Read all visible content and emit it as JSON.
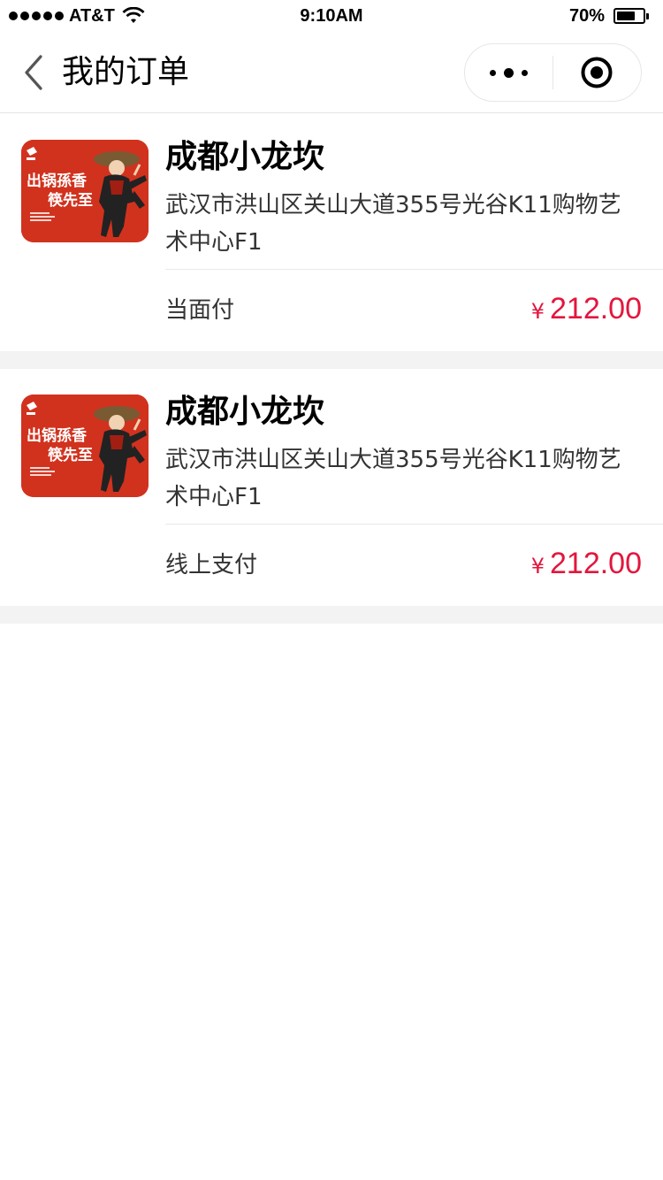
{
  "status_bar": {
    "carrier": "AT&T",
    "time": "9:10AM",
    "battery": "70%"
  },
  "nav": {
    "title": "我的订单"
  },
  "orders": [
    {
      "shop_name": "成都小龙坎",
      "address": "武汉市洪山区关山大道355号光谷K11购物艺术中心F1",
      "payment_method": "当面付",
      "currency": "¥",
      "amount": "212.00"
    },
    {
      "shop_name": "成都小龙坎",
      "address": "武汉市洪山区关山大道355号光谷K11购物艺术中心F1",
      "payment_method": "线上支付",
      "currency": "¥",
      "amount": "212.00"
    }
  ],
  "thumb_text": {
    "line1": "出锅孫香",
    "line2": "筷先至"
  },
  "colors": {
    "price": "#e3163d",
    "thumb_bg": "#d1321e",
    "gap": "#f3f3f3"
  },
  "icons": {
    "back": "chevron-left-icon",
    "more": "more-dots-icon",
    "close": "target-circle-icon",
    "wifi": "wifi-icon",
    "battery": "battery-icon"
  }
}
